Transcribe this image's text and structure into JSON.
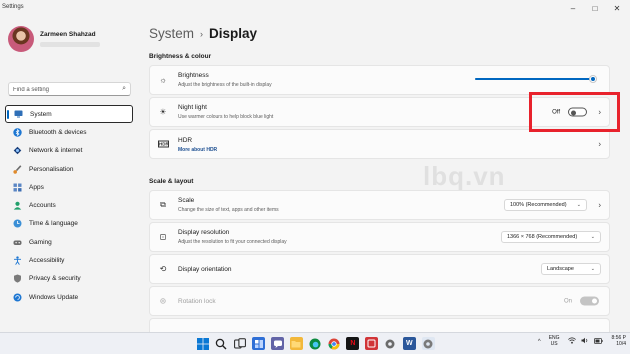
{
  "window": {
    "app_title": "Settings",
    "controls": [
      "–",
      "□",
      "✕"
    ]
  },
  "profile": {
    "name": "Zarmeen Shahzad"
  },
  "search": {
    "placeholder": "Find a setting"
  },
  "sidebar": {
    "items": [
      {
        "label": "System",
        "icon": "monitor-icon",
        "active": true
      },
      {
        "label": "Bluetooth & devices",
        "icon": "bluetooth-icon"
      },
      {
        "label": "Network & internet",
        "icon": "wifi-icon"
      },
      {
        "label": "Personalisation",
        "icon": "brush-icon"
      },
      {
        "label": "Apps",
        "icon": "apps-icon"
      },
      {
        "label": "Accounts",
        "icon": "person-icon"
      },
      {
        "label": "Time & language",
        "icon": "globe-clock-icon"
      },
      {
        "label": "Gaming",
        "icon": "gamepad-icon"
      },
      {
        "label": "Accessibility",
        "icon": "accessibility-icon"
      },
      {
        "label": "Privacy & security",
        "icon": "shield-icon"
      },
      {
        "label": "Windows Update",
        "icon": "update-icon"
      }
    ]
  },
  "breadcrumb": {
    "parent": "System",
    "separator": "›",
    "current": "Display"
  },
  "sections": {
    "brightness_colour": "Brightness & colour",
    "scale_layout": "Scale & layout"
  },
  "brightness": {
    "title": "Brightness",
    "subtitle": "Adjust the brightness of the built-in display",
    "value_fraction": 0.97
  },
  "night_light": {
    "title": "Night light",
    "subtitle": "Use warmer colours to help block blue light",
    "state": "Off"
  },
  "hdr": {
    "title": "HDR",
    "link": "More about HDR",
    "icon_text": "HDR"
  },
  "scale": {
    "title": "Scale",
    "subtitle": "Change the size of text, apps and other items",
    "value": "100% (Recommended)"
  },
  "resolution": {
    "title": "Display resolution",
    "subtitle": "Adjust the resolution to fit your connected display",
    "value": "1366 × 768 (Recommended)"
  },
  "orientation": {
    "title": "Display orientation",
    "value": "Landscape"
  },
  "rotation_lock": {
    "title": "Rotation lock",
    "state": "On"
  },
  "watermark": "lbq.vn",
  "taskbar": {
    "language": "ENG",
    "region": "US",
    "time": "8:56 P",
    "date": "10/4",
    "tray_chevron": "^"
  },
  "colors": {
    "accent": "#0067c0",
    "highlight_box": "#e8222c"
  }
}
